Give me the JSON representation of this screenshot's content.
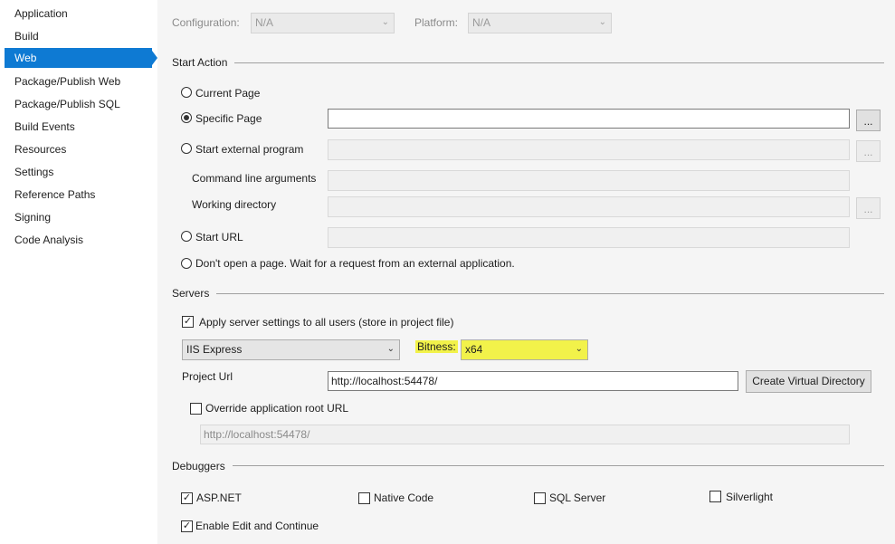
{
  "sidebar": {
    "items": [
      {
        "label": "Application"
      },
      {
        "label": "Build"
      },
      {
        "label": "Web"
      },
      {
        "label": "Package/Publish Web"
      },
      {
        "label": "Package/Publish SQL"
      },
      {
        "label": "Build Events"
      },
      {
        "label": "Resources"
      },
      {
        "label": "Settings"
      },
      {
        "label": "Reference Paths"
      },
      {
        "label": "Signing"
      },
      {
        "label": "Code Analysis"
      }
    ],
    "active_color": "#0e7ad3"
  },
  "top": {
    "configuration_label": "Configuration:",
    "configuration_value": "N/A",
    "platform_label": "Platform:",
    "platform_value": "N/A"
  },
  "start_action": {
    "title": "Start Action",
    "current_page": "Current Page",
    "specific_page": "Specific Page",
    "specific_page_value": "",
    "start_external_program": "Start external program",
    "command_line_arguments": "Command line arguments",
    "working_directory": "Working directory",
    "start_url": "Start URL",
    "dont_open": "Don't open a page.  Wait for a request from an external application.",
    "browse_label": "...",
    "selected": "Specific Page"
  },
  "servers": {
    "title": "Servers",
    "apply_settings": "Apply server settings to all users (store in project file)",
    "apply_checked": true,
    "server_value": "IIS Express",
    "bitness_label": "Bitness:",
    "bitness_value": "x64",
    "project_url_label": "Project Url",
    "project_url_value": "http://localhost:54478/",
    "create_virtual_directory": "Create Virtual Directory",
    "override_root_url": "Override application root URL",
    "override_checked": false,
    "root_url_value": "http://localhost:54478/",
    "highlight_color": "#f2f24a"
  },
  "debuggers": {
    "title": "Debuggers",
    "asp_net": "ASP.NET",
    "asp_net_checked": true,
    "native_code": "Native Code",
    "native_code_checked": false,
    "sql_server": "SQL Server",
    "sql_server_checked": false,
    "silverlight": "Silverlight",
    "silverlight_checked": false,
    "edit_and_continue": "Enable Edit and Continue",
    "edit_and_continue_checked": true
  }
}
